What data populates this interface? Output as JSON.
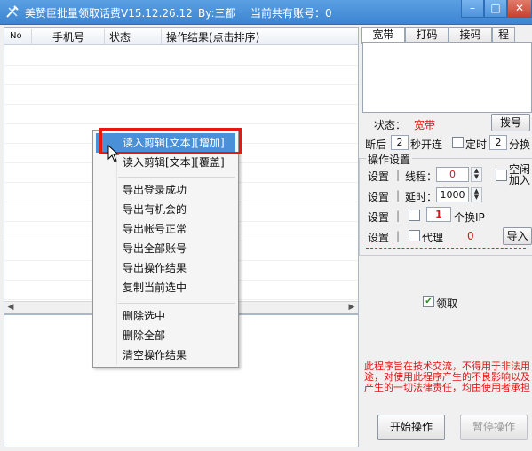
{
  "window": {
    "title": "美赞臣批量领取话费V15.12.26.12",
    "author": "By:三都",
    "account_count": "当前共有账号：0",
    "min_glyph": "–",
    "max_glyph": "□",
    "close_glyph": "✕"
  },
  "list": {
    "columns": [
      "No",
      "手机号",
      "状态",
      "操作结果(点击排序)"
    ],
    "scroll_left": "◀",
    "scroll_right": "▶"
  },
  "tabs": [
    "宽带",
    "打码",
    "接码",
    "程"
  ],
  "status": {
    "label": "状态：",
    "value": "宽带",
    "dial_button": "拨号",
    "disconnect_label": "断后",
    "disconnect_value": "2",
    "disconnect_suffix": "秒开连",
    "timer_label": "定时",
    "timer_value": "2",
    "timer_suffix": "分换"
  },
  "operation": {
    "group_title": "操作设置",
    "row1": {
      "prefix": "设置",
      "label": "线程：",
      "value": "0",
      "idle_label_1": "空闲",
      "idle_label_2": "加入"
    },
    "row2": {
      "prefix": "设置",
      "label": "延时：",
      "value": "1000"
    },
    "row3": {
      "prefix": "设置",
      "value": "1",
      "suffix": "个换IP"
    },
    "row4": {
      "prefix": "设置",
      "proxy_label": "代理",
      "proxy_value": "0",
      "import_button": "导入"
    }
  },
  "receive": {
    "label": "领取",
    "checked": true
  },
  "disclaimer": "此程序旨在技术交流，不得用于非法用途，对使用此程序产生的不良影响以及产生的一切法律责任，均由使用者承担",
  "buttons": {
    "start": "开始操作",
    "pause": "暂停操作"
  },
  "context_menu": {
    "items": [
      "读入剪辑[文本][增加]",
      "读入剪辑[文本][覆盖]",
      "导出登录成功",
      "导出有机会的",
      "导出帐号正常",
      "导出全部账号",
      "导出操作结果",
      "复制当前选中",
      "删除选中",
      "删除全部",
      "清空操作结果"
    ],
    "highlighted_index": 0
  },
  "colors": {
    "title_bar": "#3d84d2",
    "highlight": "#4a90d9",
    "annotation_red": "#e8170f",
    "disclaimer_red": "#e01414"
  },
  "icons": [
    "app-icon",
    "minimize-icon",
    "maximize-icon",
    "close-icon",
    "spin-up-icon",
    "spin-down-icon",
    "checkbox-icon",
    "mouse-cursor-icon"
  ]
}
